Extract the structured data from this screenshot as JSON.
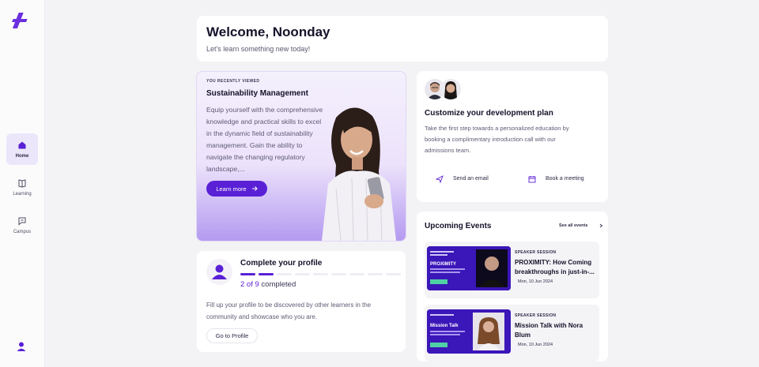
{
  "sidebar": {
    "items": [
      {
        "label": "Home",
        "icon": "home-icon",
        "active": true
      },
      {
        "label": "Learning",
        "icon": "book-icon",
        "active": false
      },
      {
        "label": "Campus",
        "icon": "chat-icon",
        "active": false
      }
    ]
  },
  "welcome": {
    "title": "Welcome, Noonday",
    "subtitle": "Let's learn something new today!"
  },
  "recent": {
    "eyebrow": "YOU RECENTLY VIEWED",
    "title": "Sustainability Management",
    "description": "Equip yourself with the comprehensive knowledge and practical skills to excel in the dynamic field of sustainability management. Gain the ability to navigate the changing regulatory landscape,...",
    "button": "Learn more"
  },
  "profile": {
    "title": "Complete your profile",
    "completed": 2,
    "total": 9,
    "count_prefix": "2 of 9",
    "count_suffix": "completed",
    "description": "Fill up your profile to be discovered by other learners in the community and showcase who you are.",
    "button": "Go to Profile"
  },
  "development": {
    "title": "Customize your development plan",
    "description": "Take the first step towards a personalized education by booking a complimentary introduction call with our admissions team.",
    "email_label": "Send an email",
    "meeting_label": "Book a meeting"
  },
  "events": {
    "title": "Upcoming Events",
    "see_all": "See all events",
    "items": [
      {
        "kicker": "SPEAKER SESSION",
        "title": "PROXIMITY: How Coming breakthroughs in just-in-...",
        "date": "Mon, 10 Jun 2024",
        "thumb_title": "PROXIMITY"
      },
      {
        "kicker": "SPEAKER SESSION",
        "title": "Mission Talk with Nora Blum",
        "date": "Mon, 10 Jun 2024",
        "thumb_title": "Mission Talk"
      }
    ]
  },
  "colors": {
    "accent": "#5a20d6",
    "accent_light": "#ece6fb",
    "background": "#f3f2f5"
  }
}
